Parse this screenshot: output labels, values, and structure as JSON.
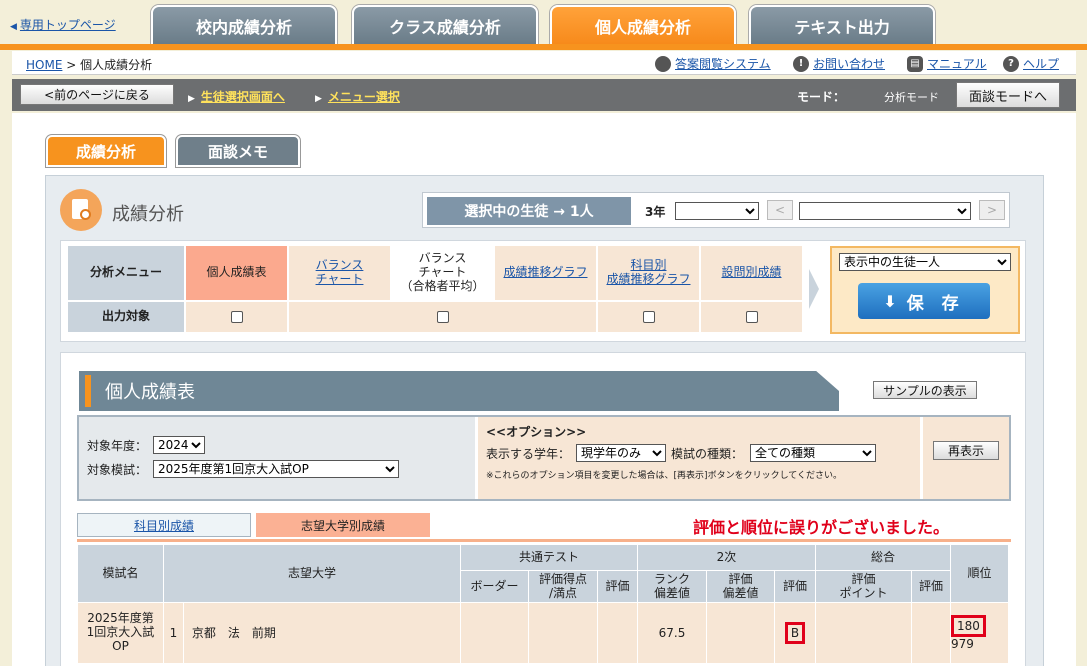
{
  "top": {
    "home_link": "専用トップページ",
    "tabs": [
      "校内成績分析",
      "クラス成績分析",
      "個人成績分析",
      "テキスト出力"
    ]
  },
  "breadcrumb": {
    "home": "HOME",
    "sep": ">",
    "current": "個人成績分析"
  },
  "util_links": [
    "答案閲覧システム",
    "お問い合わせ",
    "マニュアル",
    "ヘルプ"
  ],
  "nav": {
    "back_button": "<前のページに戻る",
    "link_students": "生徒選択画面へ",
    "link_menu": "メニュー選択",
    "mode_label": "モード：",
    "mode_value": "分析モード",
    "interview_button": "面談モードへ"
  },
  "subtabs": [
    "成績分析",
    "面談メモ"
  ],
  "page_title": "成績分析",
  "selection": {
    "badge": "選択中の生徒 → 1人",
    "grade": "3年",
    "prev": "<",
    "next": ">"
  },
  "analysis_menu": {
    "label": "分析メニュー",
    "output_label": "出力対象",
    "items": [
      {
        "label": "個人成績表",
        "link": false
      },
      {
        "label": "バランス\nチャート",
        "link": true
      },
      {
        "label": "バランス\nチャート\n（合格者平均）",
        "link": false
      },
      {
        "label": "成績推移グラフ",
        "link": true
      },
      {
        "label": "科目別\n成績推移グラフ",
        "link": true
      },
      {
        "label": "設問別成績",
        "link": true
      }
    ],
    "target_select": "表示中の生徒一人",
    "save_button": "保 存"
  },
  "report": {
    "title": "個人成績表",
    "sample_button": "サンプルの表示",
    "year_label": "対象年度：",
    "year_value": "2024",
    "exam_label": "対象模試：",
    "exam_value": "2025年度第1回京大入試OP",
    "option_title": "<<オプション>>",
    "grade_label": "表示する学年：",
    "grade_value": "現学年のみ",
    "kind_label": "模試の種類：",
    "kind_value": "全ての種類",
    "option_note": "※これらのオプション項目を変更した場合は、[再表示]ボタンをクリックしてください。",
    "redisplay_button": "再表示",
    "tab_subject": "科目別成績",
    "tab_university": "志望大学別成績",
    "error_message": "評価と順位に誤りがございました。"
  },
  "table": {
    "headers": {
      "exam_name": "模試名",
      "university": "志望大学",
      "common_test": "共通テスト",
      "second": "2次",
      "total": "総合",
      "rank": "順位",
      "border": "ボーダー",
      "score": "評価得点\n/満点",
      "eval": "評価",
      "rank_dev": "ランク\n偏差値",
      "eval_dev": "評価\n偏差値",
      "eval_point": "評価\nポイント"
    },
    "row": {
      "exam": "2025年度第\n1回京大入試\nOP",
      "no": "1",
      "university": "京都　法　前期",
      "rank_dev": "67.5",
      "eval2": "B",
      "rank": "180",
      "rank_total": "979"
    }
  },
  "colors": {
    "accent": "#f7931e",
    "error": "#e0001a",
    "link": "#1a55a8"
  }
}
